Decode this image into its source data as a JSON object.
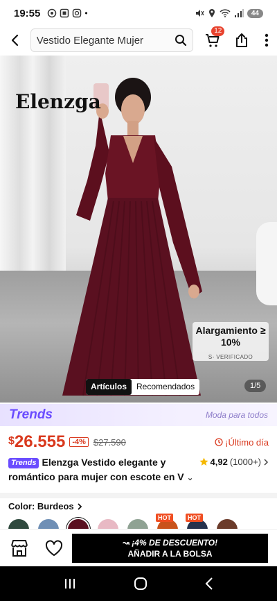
{
  "status_bar": {
    "time": "19:55",
    "battery": "44"
  },
  "search": {
    "query": "Vestido Elegante Mujer",
    "cart_count": "12"
  },
  "gallery": {
    "brand_logo": "Elenzga",
    "promo_title": "Alargamiento ≥ 10%",
    "promo_subtitle": "S- VERIFICADO",
    "tabs": [
      "Artículos",
      "Recomendados"
    ],
    "counter": "1/5"
  },
  "trends": {
    "logo": "Trends",
    "slogan": "Moda para todos"
  },
  "price": {
    "currency": "$",
    "current": "26.555",
    "discount": "-4%",
    "original": "$27.590",
    "urgency": "¡Último día"
  },
  "product": {
    "badge": "Trends",
    "title": "Elenzga Vestido elegante y romántico para mujer con escote en V",
    "rating": "4,92",
    "review_count": "(1000+)"
  },
  "color": {
    "label": "Color: Burdeos",
    "swatches": [
      {
        "name": "verde oscuro",
        "color": "#2f4a3f"
      },
      {
        "name": "azul",
        "color": "#6f8fb5"
      },
      {
        "name": "burdeos",
        "color": "#5a1020",
        "selected": true
      },
      {
        "name": "rosa",
        "color": "#e8b9c4"
      },
      {
        "name": "salvia",
        "color": "#8fa293"
      },
      {
        "name": "naranja",
        "color": "#c9531c",
        "badge": "HOT"
      },
      {
        "name": "azul marino",
        "color": "#25324d",
        "badge": "HOT"
      },
      {
        "name": "marrón",
        "color": "#6b3b2a"
      }
    ]
  },
  "actions": {
    "discount_label": "¡4% DE DESCUENTO!",
    "add_to_bag": "AÑADIR A LA BOLSA"
  },
  "colors": {
    "accent": "#d9391e",
    "trends": "#6a4cff"
  }
}
